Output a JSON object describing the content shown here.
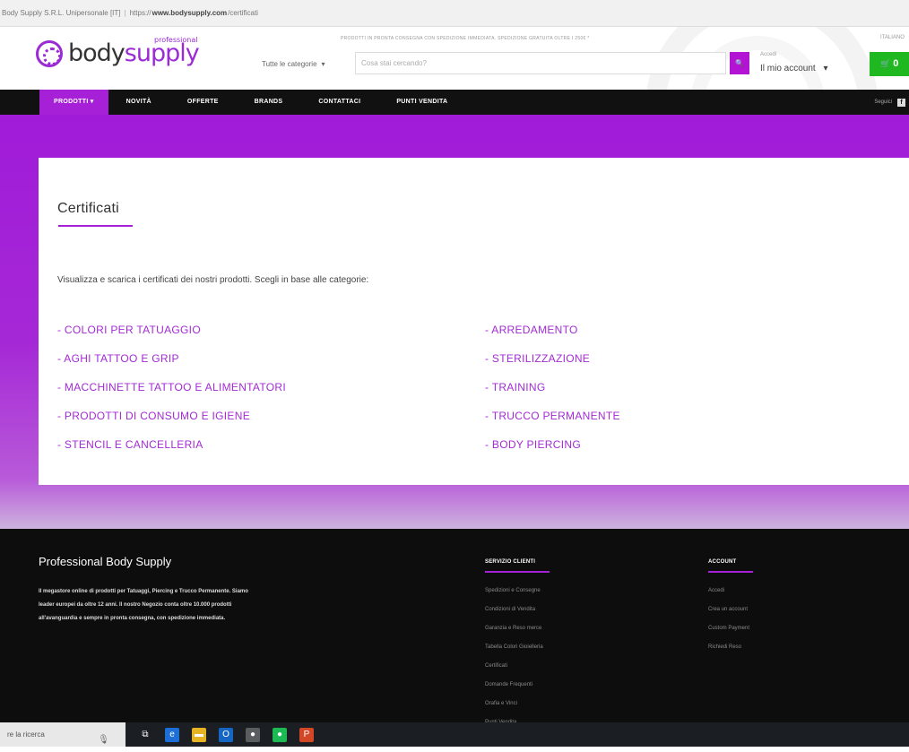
{
  "browser": {
    "site_info": "Body Supply S.R.L. Unipersonale [IT]",
    "url_prefix": "https://",
    "url_domain": "www.bodysupply.com",
    "url_path": "/certificati"
  },
  "header": {
    "logo_body": "body",
    "logo_supply": "supply",
    "logo_pro": "professional",
    "promo": "PRODOTTI IN PRONTA CONSEGNA CON SPEDIZIONE IMMEDIATA. SPEDIZIONE GRATUITA OLTRE I 250€ *",
    "category": "Tutte le categorie",
    "category_caret": "▾",
    "search_placeholder": "Cosa stai cercando?",
    "search_icon": "🔍",
    "account_small": "Accedi",
    "account_label": "Il mio account",
    "account_caret": "▾",
    "language": "ITALIANO",
    "cart_icon": "🛒",
    "cart_count": "0"
  },
  "nav": {
    "items": [
      "PRODOTTI ▾",
      "NOVITÀ",
      "OFFERTE",
      "BRANDS",
      "CONTATTACI",
      "PUNTI VENDITA"
    ],
    "right_text": "Seguici",
    "fb_glyph": "f"
  },
  "page": {
    "title": "Certificati",
    "intro": "Visualizza e scarica i certificati dei nostri prodotti. Scegli in base alle categorie:",
    "left_categories": [
      "- COLORI PER TATUAGGIO",
      "- AGHI TATTOO E GRIP",
      "- MACCHINETTE TATTOO E ALIMENTATORI",
      "- PRODOTTI DI CONSUMO E IGIENE",
      "- STENCIL E CANCELLERIA"
    ],
    "right_categories": [
      "- ARREDAMENTO",
      "- STERILIZZAZIONE",
      "- TRAINING",
      "- TRUCCO PERMANENTE",
      "- BODY PIERCING"
    ]
  },
  "footer": {
    "title": "Professional Body Supply",
    "description": "Il megastore online di prodotti per Tatuaggi, Piercing e Trucco Permanente. Siamo leader europei da oltre 12 anni. Il nostro Negozio conta oltre 10.000 prodotti all'avanguardia e sempre in pronta consegna, con spedizione immediata.",
    "services_title": "SERVIZIO CLIENTI",
    "services_links": [
      "Spedizioni e Consegne",
      "Condizioni di Vendita",
      "Garanzia e Reso merce",
      "Tabella Colori Gioielleria",
      "Certificati",
      "Domande Frequenti",
      "Orafia e Vinci",
      "Punti Vendita"
    ],
    "account_title": "ACCOUNT",
    "account_links": [
      "Accedi",
      "Crea un account",
      "Custom Payment",
      "Richiedi Reso"
    ]
  },
  "taskbar": {
    "search_placeholder": "re la ricerca",
    "mic": "🎙",
    "icons": [
      {
        "name": "task-view-icon",
        "glyph": "⧉",
        "color": "#1b1f24"
      },
      {
        "name": "edge-icon",
        "glyph": "e",
        "color": "#1d6fd6"
      },
      {
        "name": "file-explorer-icon",
        "glyph": "▬",
        "color": "#e6b422"
      },
      {
        "name": "outlook-icon",
        "glyph": "O",
        "color": "#1466c2"
      },
      {
        "name": "chrome-icon",
        "glyph": "●",
        "color": "#5a5d60"
      },
      {
        "name": "spotify-icon",
        "glyph": "●",
        "color": "#1db954"
      },
      {
        "name": "powerpoint-icon",
        "glyph": "P",
        "color": "#d24726"
      }
    ]
  }
}
